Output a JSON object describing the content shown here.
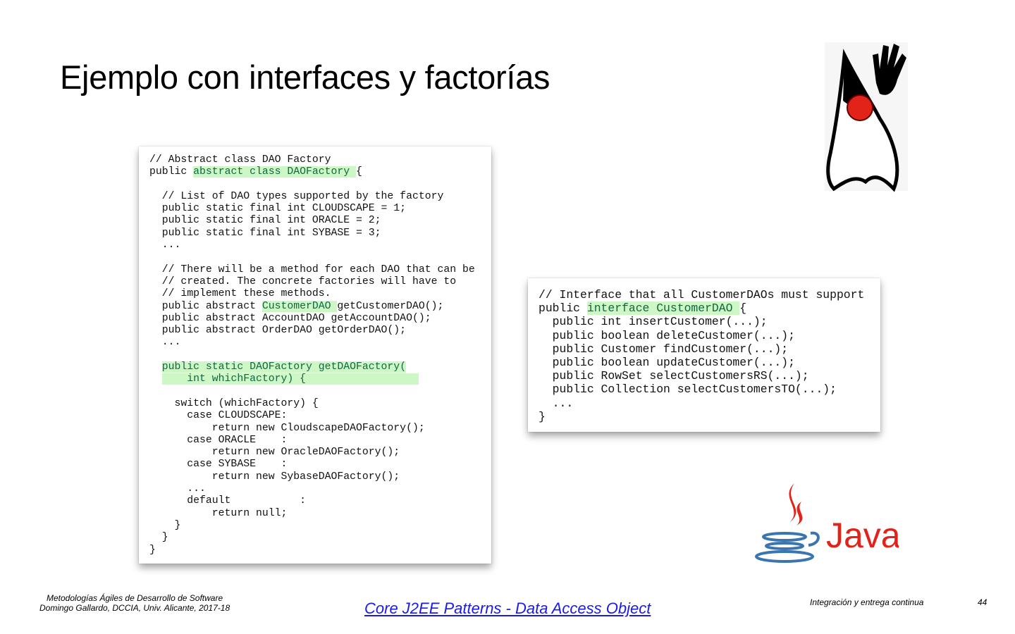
{
  "title": "Ejemplo con interfaces y factorías",
  "left_code": [
    [
      [
        "// Abstract class DAO Factory",
        false
      ]
    ],
    [
      [
        "public ",
        false
      ],
      [
        "abstract class DAOFactory ",
        true
      ],
      [
        "{",
        false
      ]
    ],
    [
      [
        "",
        false
      ]
    ],
    [
      [
        "  // List of DAO types supported by the factory",
        false
      ]
    ],
    [
      [
        "  public static final int CLOUDSCAPE = 1;",
        false
      ]
    ],
    [
      [
        "  public static final int ORACLE = 2;",
        false
      ]
    ],
    [
      [
        "  public static final int SYBASE = 3;",
        false
      ]
    ],
    [
      [
        "  ...",
        false
      ]
    ],
    [
      [
        "",
        false
      ]
    ],
    [
      [
        "  // There will be a method for each DAO that can be",
        false
      ]
    ],
    [
      [
        "  // created. The concrete factories will have to",
        false
      ]
    ],
    [
      [
        "  // implement these methods.",
        false
      ]
    ],
    [
      [
        "  public abstract ",
        false
      ],
      [
        "CustomerDAO ",
        true
      ],
      [
        "getCustomerDAO();",
        false
      ]
    ],
    [
      [
        "  public abstract AccountDAO getAccountDAO();",
        false
      ]
    ],
    [
      [
        "  public abstract OrderDAO getOrderDAO();",
        false
      ]
    ],
    [
      [
        "  ...",
        false
      ]
    ],
    [
      [
        "",
        false
      ]
    ],
    [
      [
        "  ",
        false
      ],
      [
        "public static DAOFactory getDAOFactory(",
        true
      ]
    ],
    [
      [
        "  ",
        false
      ],
      [
        "    int whichFactory) {                  ",
        true
      ]
    ],
    [
      [
        "",
        false
      ]
    ],
    [
      [
        "    switch (whichFactory) {",
        false
      ]
    ],
    [
      [
        "      case CLOUDSCAPE:",
        false
      ]
    ],
    [
      [
        "          return new CloudscapeDAOFactory();",
        false
      ]
    ],
    [
      [
        "      case ORACLE    :",
        false
      ]
    ],
    [
      [
        "          return new OracleDAOFactory();",
        false
      ]
    ],
    [
      [
        "      case SYBASE    :",
        false
      ]
    ],
    [
      [
        "          return new SybaseDAOFactory();",
        false
      ]
    ],
    [
      [
        "      ...",
        false
      ]
    ],
    [
      [
        "      default           :",
        false
      ]
    ],
    [
      [
        "          return null;",
        false
      ]
    ],
    [
      [
        "    }",
        false
      ]
    ],
    [
      [
        "  }",
        false
      ]
    ],
    [
      [
        "}",
        false
      ]
    ]
  ],
  "right_code": [
    [
      [
        "// Interface that all CustomerDAOs must support",
        false
      ]
    ],
    [
      [
        "public ",
        false
      ],
      [
        "interface CustomerDAO ",
        true
      ],
      [
        "{",
        false
      ]
    ],
    [
      [
        "  public int insertCustomer(...);",
        false
      ]
    ],
    [
      [
        "  public boolean deleteCustomer(...);",
        false
      ]
    ],
    [
      [
        "  public Customer findCustomer(...);",
        false
      ]
    ],
    [
      [
        "  public boolean updateCustomer(...);",
        false
      ]
    ],
    [
      [
        "  public RowSet selectCustomersRS(...);",
        false
      ]
    ],
    [
      [
        "  public Collection selectCustomersTO(...);",
        false
      ]
    ],
    [
      [
        "  ...",
        false
      ]
    ],
    [
      [
        "}",
        false
      ]
    ]
  ],
  "java_logo_text": "Java",
  "footer": {
    "course": "Metodologías Ágiles de Desarrollo de Software",
    "author": "Domingo Gallardo, DCCIA, Univ. Alicante, 2017-18",
    "link": "Core J2EE Patterns - Data Access Object",
    "section": "Integración y entrega continua",
    "page": "44"
  },
  "colors": {
    "highlight": "#cdf7c4",
    "link": "#1a1aee",
    "java_red": "#e2231a",
    "java_blue": "#3a75b0"
  }
}
